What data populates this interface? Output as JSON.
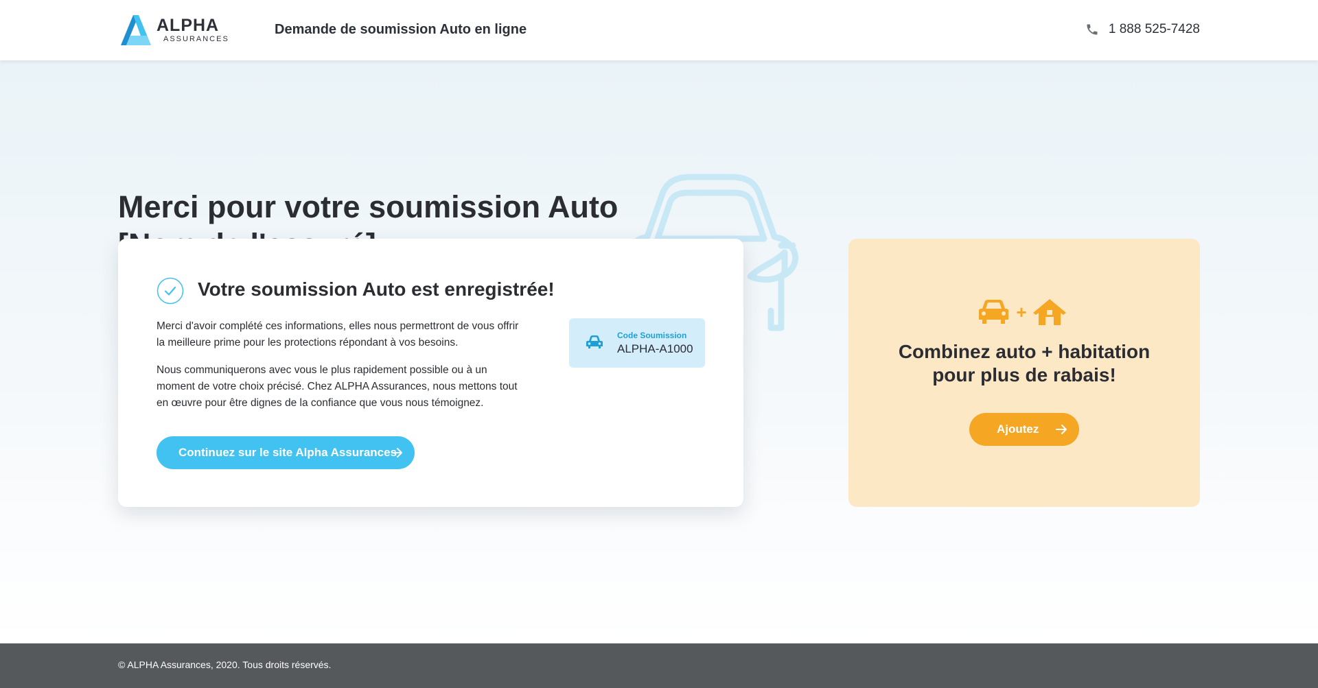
{
  "header": {
    "logo_name": "ALPHA",
    "logo_sub": "ASSURANCES",
    "title": "Demande de soumission Auto en ligne",
    "phone": "1 888 525-7428"
  },
  "main": {
    "title_line1": "Merci pour votre soumission Auto",
    "title_line2": "[Nom de l'assuré]"
  },
  "confirmation": {
    "title": "Votre soumission Auto est enregistrée!",
    "paragraph1": "Merci d'avoir complété ces informations, elles nous permettront de vous offrir la meilleure prime pour les protections répondant à vos besoins.",
    "paragraph2": "Nous communiquerons avec vous le plus rapidement possible ou à un moment de votre choix précisé. Chez ALPHA Assurances, nous mettons tout en œuvre pour être dignes de la confiance que vous nous témoignez.",
    "button_label": "Continuez sur le site Alpha Assurances",
    "code_label": "Code Soumission",
    "code_value": "ALPHA-A1000"
  },
  "promo": {
    "plus_sign": "+",
    "title_line1": "Combinez auto + habitation",
    "title_line2": "pour plus de rabais!",
    "button_label": "Ajoutez"
  },
  "footer": {
    "copyright": "© ALPHA Assurances, 2020. Tous droits réservés."
  },
  "colors": {
    "primary_blue": "#42c2f0",
    "accent_orange": "#f5a623",
    "promo_background": "#fde8c6",
    "code_background": "#d3eefa",
    "footer_background": "#55595c"
  },
  "icons": {
    "logo": "alpha-logo-icon",
    "phone": "phone-icon",
    "background_car": "car-outline-icon",
    "check": "check-circle-icon",
    "code_car": "car-icon",
    "promo_car": "car-icon",
    "promo_house": "house-icon",
    "arrow": "arrow-right-icon"
  }
}
